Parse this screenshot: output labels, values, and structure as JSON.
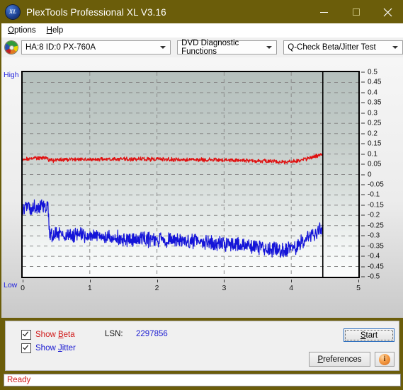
{
  "window": {
    "title": "PlexTools Professional XL V3.16",
    "app_icon": "xl-logo-icon",
    "minimize_label": "minimize-icon",
    "maximize_label": "maximize-icon",
    "close_label": "close-icon",
    "titlebar_color": "#6b5d0a"
  },
  "menubar": {
    "items": [
      {
        "label": "Options",
        "accel": "O"
      },
      {
        "label": "Help",
        "accel": "H"
      }
    ]
  },
  "toolbar": {
    "drive_icon": "disc-icon",
    "drive": {
      "value": "HA:8 ID:0  PX-760A"
    },
    "function": {
      "value": "DVD Diagnostic Functions"
    },
    "test": {
      "value": "Q-Check Beta/Jitter Test"
    }
  },
  "chart_panel": {
    "label_high": "High",
    "label_low": "Low"
  },
  "controls": {
    "show_beta": {
      "label": "Show Beta",
      "accel": "B",
      "checked": true,
      "color": "#d11a1a"
    },
    "show_jitter": {
      "label": "Show Jitter",
      "accel": "J",
      "checked": true,
      "color": "#1a1ad1"
    },
    "lsn_label": "LSN:",
    "lsn_value": "2297856",
    "start_button": {
      "label": "Start",
      "accel": "S"
    },
    "preferences_button": {
      "label": "Preferences",
      "accel": "P"
    },
    "info_button": {
      "label": "i",
      "name": "info-icon"
    }
  },
  "statusbar": {
    "text": "Ready",
    "color": "#d11a1a"
  },
  "chart_data": {
    "type": "line",
    "title": "Q-Check Beta/Jitter Test",
    "xlabel": "",
    "ylabel": "",
    "xlim": [
      0,
      5
    ],
    "ylim": [
      -0.5,
      0.5
    ],
    "xticks": [
      0,
      1,
      2,
      3,
      4,
      5
    ],
    "yticks": [
      0.5,
      0.45,
      0.4,
      0.35,
      0.3,
      0.25,
      0.2,
      0.15,
      0.1,
      0.05,
      0,
      -0.05,
      -0.1,
      -0.15,
      -0.2,
      -0.25,
      -0.3,
      -0.35,
      -0.4,
      -0.45,
      -0.5
    ],
    "grid": true,
    "grid_style": "dashed",
    "left_axis_top_label": "High",
    "left_axis_bottom_label": "Low",
    "legend_position": "below-plot",
    "marker_line_x": 4.47,
    "series": [
      {
        "name": "Beta",
        "color": "#e01010",
        "x": [
          0.0,
          0.1,
          0.2,
          0.3,
          0.35,
          0.4,
          0.45,
          0.5,
          0.6,
          0.7,
          0.8,
          0.9,
          1.0,
          1.2,
          1.4,
          1.6,
          1.8,
          2.0,
          2.2,
          2.4,
          2.6,
          2.8,
          3.0,
          3.2,
          3.4,
          3.6,
          3.7,
          3.8,
          3.9,
          4.0,
          4.1,
          4.2,
          4.3,
          4.4,
          4.47
        ],
        "y": [
          0.073,
          0.075,
          0.08,
          0.082,
          0.08,
          0.07,
          0.068,
          0.072,
          0.073,
          0.073,
          0.074,
          0.074,
          0.074,
          0.074,
          0.075,
          0.075,
          0.075,
          0.075,
          0.074,
          0.073,
          0.072,
          0.071,
          0.07,
          0.069,
          0.068,
          0.066,
          0.064,
          0.061,
          0.06,
          0.063,
          0.068,
          0.074,
          0.082,
          0.093,
          0.1
        ],
        "noise_amplitude": 0.008
      },
      {
        "name": "Jitter",
        "color": "#1414d8",
        "x": [
          0.0,
          0.1,
          0.2,
          0.3,
          0.38,
          0.4,
          0.42,
          0.5,
          0.6,
          0.7,
          0.8,
          0.9,
          1.0,
          1.2,
          1.4,
          1.6,
          1.8,
          2.0,
          2.2,
          2.4,
          2.6,
          2.8,
          3.0,
          3.2,
          3.4,
          3.6,
          3.7,
          3.8,
          3.9,
          4.0,
          4.1,
          4.2,
          4.3,
          4.4,
          4.47
        ],
        "y": [
          -0.165,
          -0.16,
          -0.158,
          -0.155,
          -0.158,
          -0.29,
          -0.295,
          -0.293,
          -0.294,
          -0.296,
          -0.298,
          -0.3,
          -0.302,
          -0.306,
          -0.312,
          -0.316,
          -0.318,
          -0.32,
          -0.323,
          -0.327,
          -0.332,
          -0.336,
          -0.34,
          -0.345,
          -0.352,
          -0.36,
          -0.364,
          -0.368,
          -0.37,
          -0.362,
          -0.345,
          -0.32,
          -0.3,
          -0.278,
          -0.27
        ],
        "noise_amplitude": 0.03,
        "step_at_x": 0.4
      }
    ]
  }
}
